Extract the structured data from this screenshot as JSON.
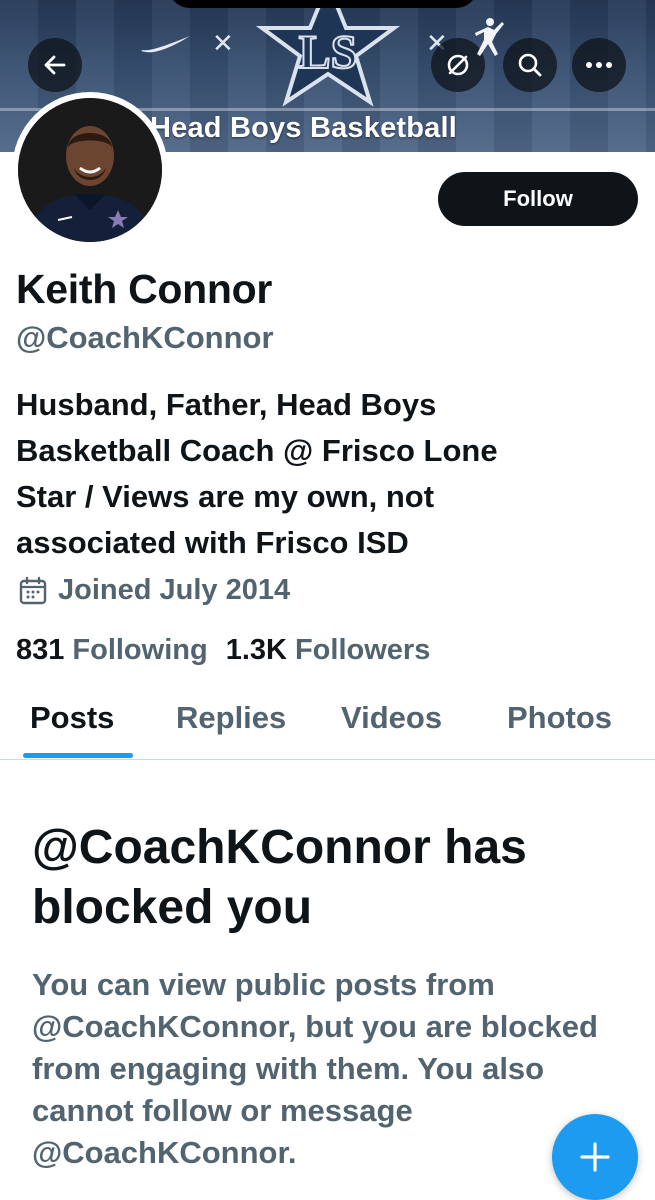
{
  "banner": {
    "text": "Head Boys Basketball",
    "logo_letters": "LS"
  },
  "header": {
    "back_icon": "arrow-left-icon",
    "search_off_icon": "slash-circle-icon",
    "search_icon": "search-icon",
    "more_icon": "more-horizontal-icon"
  },
  "profile": {
    "name": "Keith Connor",
    "handle": "@CoachKConnor",
    "bio": "Husband, Father, Head Boys\nBasketball Coach @ Frisco Lone\nStar / Views are my own, not\nassociated with Frisco ISD",
    "joined": "Joined July 2014",
    "following_count": "831",
    "following_label": "Following",
    "followers_count": "1.3K",
    "followers_label": "Followers"
  },
  "actions": {
    "follow_label": "Follow"
  },
  "tabs": [
    {
      "label": "Posts",
      "active": true
    },
    {
      "label": "Replies",
      "active": false
    },
    {
      "label": "Videos",
      "active": false
    },
    {
      "label": "Photos",
      "active": false
    }
  ],
  "blocked": {
    "title": "@CoachKConnor has blocked you",
    "body": "You can view public posts from @CoachKConnor, but you are blocked from engaging with them. You also cannot follow or message @CoachKConnor."
  },
  "colors": {
    "accent": "#1d9bf0",
    "text_primary": "#0f1419",
    "text_secondary": "#536471"
  }
}
